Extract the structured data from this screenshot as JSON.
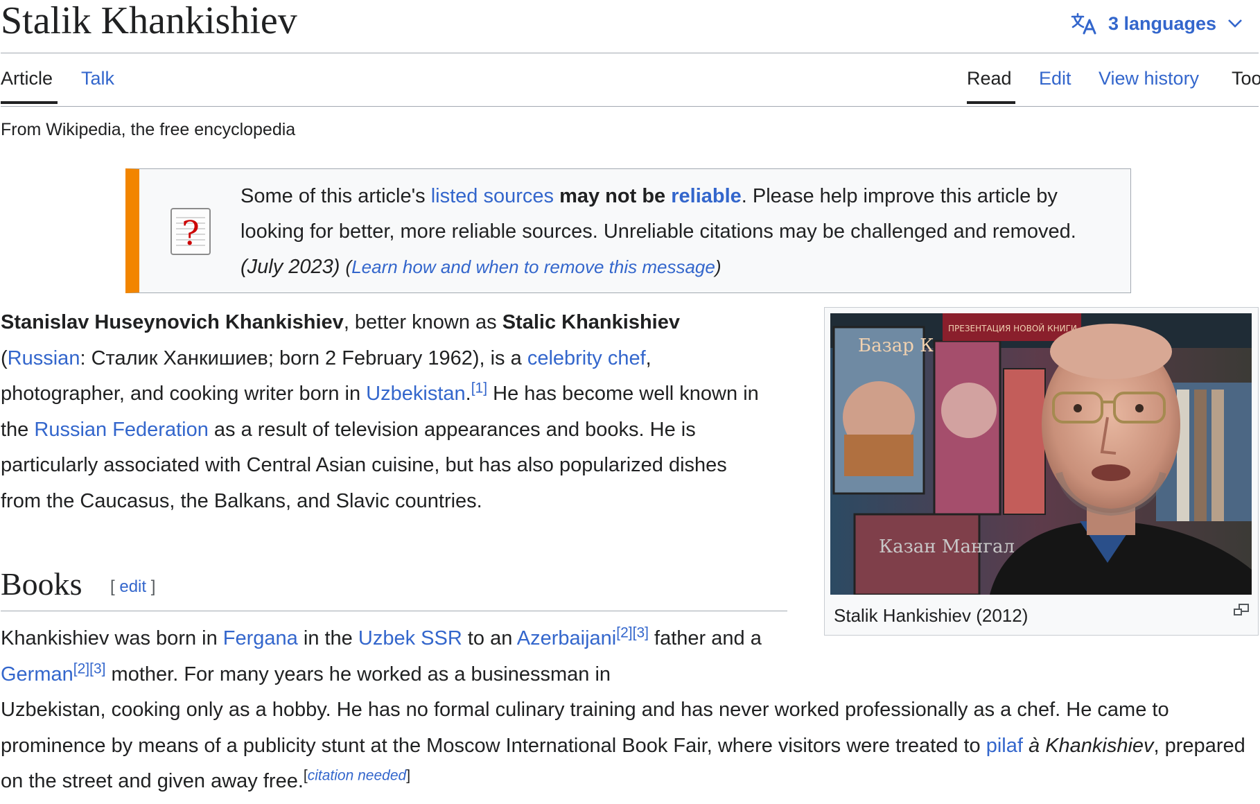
{
  "header": {
    "title": "Stalik Khankishiev",
    "languages_label": "3 languages"
  },
  "tabs": {
    "article": "Article",
    "talk": "Talk",
    "read": "Read",
    "edit": "Edit",
    "view_history": "View history",
    "tools": "Tools"
  },
  "tagline": "From Wikipedia, the free encyclopedia",
  "notice": {
    "t1": "Some of this article's ",
    "link_sources": "listed sources",
    "t2": " may not be ",
    "link_reliable": "reliable",
    "t3": ". Please help improve this article by looking for better, more reliable sources. Unreliable citations may be challenged and removed. ",
    "date": "(July 2023)",
    "open_paren": "(",
    "learn_link": "Learn how and when to remove this message",
    "close_paren": ")"
  },
  "intro": {
    "name_full": "Stanislav Huseynovich Khankishiev",
    "t1": ", better known as ",
    "name_known": "Stalic Khankishiev",
    "t2": " (",
    "link_russian": "Russian",
    "t3": ": Сталик Ханкишиев; born 2 February 1962), is a ",
    "link_chef": "celebrity chef",
    "t4": ", photographer, and cooking writer born in ",
    "link_uzbekistan": "Uzbekistan",
    "t5": ".",
    "ref1": "[1]",
    "t6": " He has become well known in the ",
    "link_russia": "Russian Federation",
    "t7": " as a result of television appearances and books. He is particularly associated with Central Asian cuisine, but has also popularized dishes from the Caucasus, the Balkans, and Slavic countries."
  },
  "books": {
    "heading": "Books",
    "edit_open": "[ ",
    "edit_link": "edit",
    "edit_close": " ]",
    "p1": {
      "t1": "Khankishiev was born in ",
      "link_fergana": "Fergana",
      "t2": " in the ",
      "link_uzbek_ssr": "Uzbek SSR",
      "t3": " to an ",
      "link_azerbaijani": "Azerbaijani",
      "ref2a": "[2]",
      "ref3a": "[3]",
      "t4": " father and a ",
      "link_german": "German",
      "ref2b": "[2]",
      "ref3b": "[3]",
      "t5": " mother. For many years he worked as a businessman in"
    },
    "p2": {
      "t1": "Uzbekistan, cooking only as a hobby. He has no formal culinary training and has never worked professionally as a chef. He came to prominence by means of a publicity stunt at the Moscow International Book Fair, where visitors were treated to ",
      "link_pilaf": "pilaf",
      "t2": " ",
      "italic1": "à Khankishiev",
      "t3": ", prepared on the street and given away free.",
      "cite_open": "[",
      "cite_needed": "citation needed",
      "cite_close": "]"
    }
  },
  "figure": {
    "caption": "Stalik Hankishiev (2012)",
    "book_text_1": "Базар Казан",
    "book_text_2": "ПРЕЗЕНТАЦИЯ НОВОЙ КНИГИ",
    "book_text_3": "Казан Мангал"
  },
  "colors": {
    "link": "#3366cc",
    "notice_bar": "#f28500",
    "text": "#202122"
  },
  "icons": {
    "translate": "translate-icon",
    "chevron": "chevron-down-icon",
    "question": "question-document-icon",
    "enlarge": "enlarge-icon"
  }
}
